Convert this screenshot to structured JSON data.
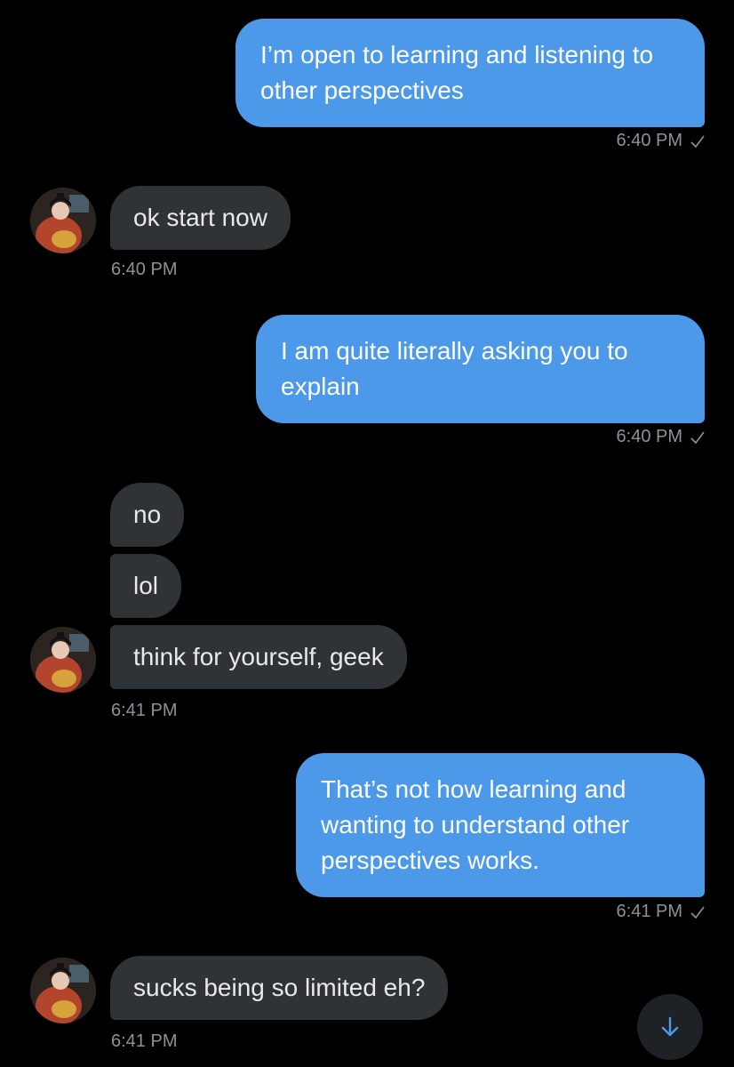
{
  "messages": [
    {
      "text": "I’m open to learning and listening to other perspectives",
      "time": "6:40 PM"
    },
    {
      "text": "ok start now",
      "time": "6:40 PM"
    },
    {
      "text": "I am quite literally asking you to explain",
      "time": "6:40 PM"
    },
    {
      "text": "no"
    },
    {
      "text": "lol"
    },
    {
      "text": "think for yourself, geek",
      "time": "6:41 PM"
    },
    {
      "text": "That’s not how learning and wanting to understand other perspectives works.",
      "time": "6:41 PM"
    },
    {
      "text": "sucks being so limited eh?",
      "time": "6:41 PM"
    }
  ],
  "colors": {
    "background": "#000000",
    "sent_bubble": "#4c99ea",
    "received_bubble": "#2f3336",
    "timestamp": "#8b9298"
  },
  "icons": {
    "read_receipt": "checkmark-icon",
    "scroll_down": "arrow-down-icon",
    "avatar": "user-avatar"
  }
}
